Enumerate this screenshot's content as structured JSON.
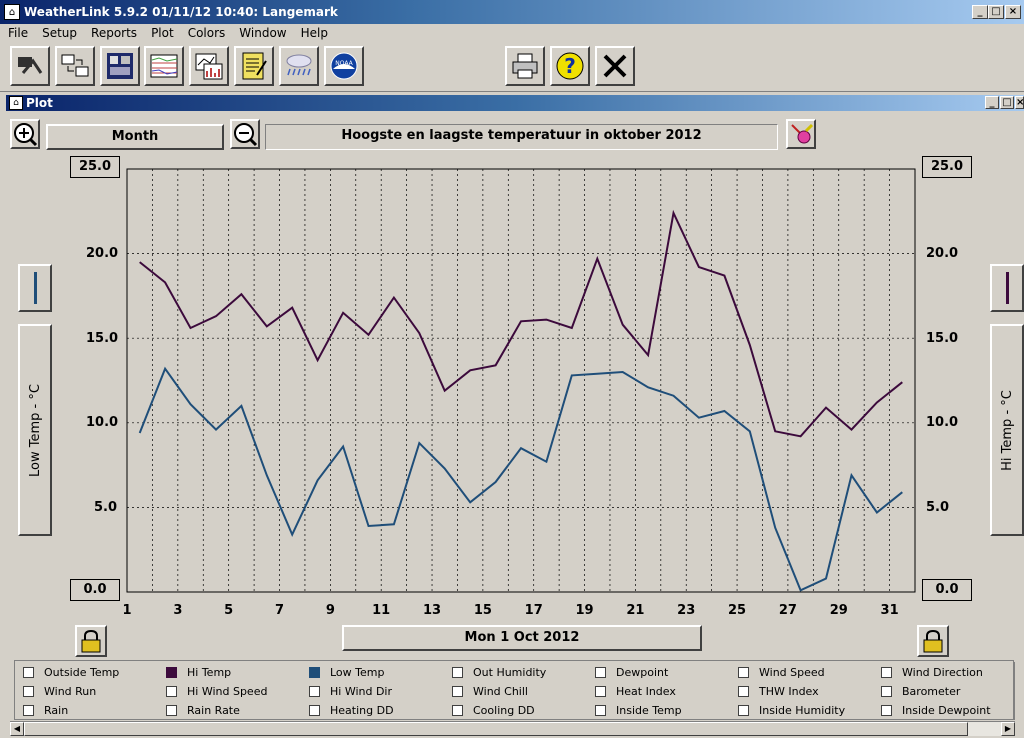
{
  "app": {
    "title": "WeatherLink 5.9.2  01/11/12  10:40: Langemark"
  },
  "menu": [
    "File",
    "Setup",
    "Reports",
    "Plot",
    "Colors",
    "Window",
    "Help"
  ],
  "plot_window": {
    "title": "Plot"
  },
  "toolbar": {
    "icons": [
      "connect-icon",
      "transfer-icon",
      "bulletin-icon",
      "strip-chart-icon",
      "summary-chart-icon",
      "notes-icon",
      "weather-icon",
      "noaa-icon",
      "print-icon",
      "help-icon",
      "close-icon"
    ],
    "noaa_label": "NOAA"
  },
  "controls": {
    "period": "Month",
    "plot_title": "Hoogste en laagste temperatuur in oktober 2012",
    "date_button": "Mon 1 Oct 2012"
  },
  "axes": {
    "left_label": "Low Temp - °C",
    "right_label": "Hi Temp - °C",
    "ticks": [
      "25.0",
      "20.0",
      "15.0",
      "10.0",
      "5.0",
      "0.0"
    ],
    "x_ticks": [
      "1",
      "3",
      "5",
      "7",
      "9",
      "11",
      "13",
      "15",
      "17",
      "19",
      "21",
      "23",
      "25",
      "27",
      "29",
      "31"
    ]
  },
  "chart_data": {
    "type": "line",
    "title": "Hoogste en laagste temperatuur in oktober 2012",
    "xlabel": "",
    "ylabel": "Low Temp - °C",
    "y2label": "Hi Temp - °C",
    "xlim": [
      1,
      32
    ],
    "ylim": [
      0,
      25
    ],
    "grid": true,
    "x": [
      1.5,
      2.5,
      3.5,
      4.5,
      5.5,
      6.5,
      7.5,
      8.5,
      9.5,
      10.5,
      11.5,
      12.5,
      13.5,
      14.5,
      15.5,
      16.5,
      17.5,
      18.5,
      19.5,
      20.5,
      21.5,
      22.5,
      23.5,
      24.5,
      25.5,
      26.5,
      27.5,
      28.5,
      29.5,
      30.5,
      31.5
    ],
    "series": [
      {
        "name": "Hi Temp",
        "color": "#3c0a3c",
        "values": [
          19.5,
          18.3,
          15.6,
          16.3,
          17.6,
          15.7,
          16.8,
          13.7,
          16.5,
          15.2,
          17.4,
          15.3,
          11.9,
          13.1,
          13.4,
          16.0,
          16.1,
          15.6,
          19.7,
          15.8,
          14.0,
          22.4,
          19.2,
          18.7,
          14.6,
          9.5,
          9.2,
          10.9,
          9.6,
          11.2,
          12.4
        ]
      },
      {
        "name": "Low Temp",
        "color": "#1f4e79",
        "values": [
          9.4,
          13.2,
          11.1,
          9.6,
          11.0,
          6.9,
          3.4,
          6.6,
          8.6,
          3.9,
          4.0,
          8.8,
          7.3,
          5.3,
          6.5,
          8.5,
          7.7,
          12.8,
          12.9,
          13.0,
          12.1,
          11.6,
          10.3,
          10.7,
          9.5,
          3.8,
          0.1,
          0.8,
          6.9,
          4.7,
          5.9
        ]
      }
    ]
  },
  "legend": [
    {
      "label": "Outside Temp",
      "checked": false,
      "color": ""
    },
    {
      "label": "Hi Temp",
      "checked": true,
      "color": "#3c0a3c"
    },
    {
      "label": "Low Temp",
      "checked": true,
      "color": "#1f4e79"
    },
    {
      "label": "Out Humidity",
      "checked": false,
      "color": ""
    },
    {
      "label": "Dewpoint",
      "checked": false,
      "color": ""
    },
    {
      "label": "Wind Speed",
      "checked": false,
      "color": ""
    },
    {
      "label": "Wind Direction",
      "checked": false,
      "color": ""
    },
    {
      "label": "Wind Run",
      "checked": false,
      "color": ""
    },
    {
      "label": "Hi Wind Speed",
      "checked": false,
      "color": ""
    },
    {
      "label": "Hi Wind Dir",
      "checked": false,
      "color": ""
    },
    {
      "label": "Wind Chill",
      "checked": false,
      "color": ""
    },
    {
      "label": "Heat Index",
      "checked": false,
      "color": ""
    },
    {
      "label": "THW Index",
      "checked": false,
      "color": ""
    },
    {
      "label": "Barometer",
      "checked": false,
      "color": ""
    },
    {
      "label": "Rain",
      "checked": false,
      "color": ""
    },
    {
      "label": "Rain Rate",
      "checked": false,
      "color": ""
    },
    {
      "label": "Heating DD",
      "checked": false,
      "color": ""
    },
    {
      "label": "Cooling DD",
      "checked": false,
      "color": ""
    },
    {
      "label": "Inside Temp",
      "checked": false,
      "color": ""
    },
    {
      "label": "Inside Humidity",
      "checked": false,
      "color": ""
    },
    {
      "label": "Inside Dewpoint",
      "checked": false,
      "color": ""
    }
  ]
}
